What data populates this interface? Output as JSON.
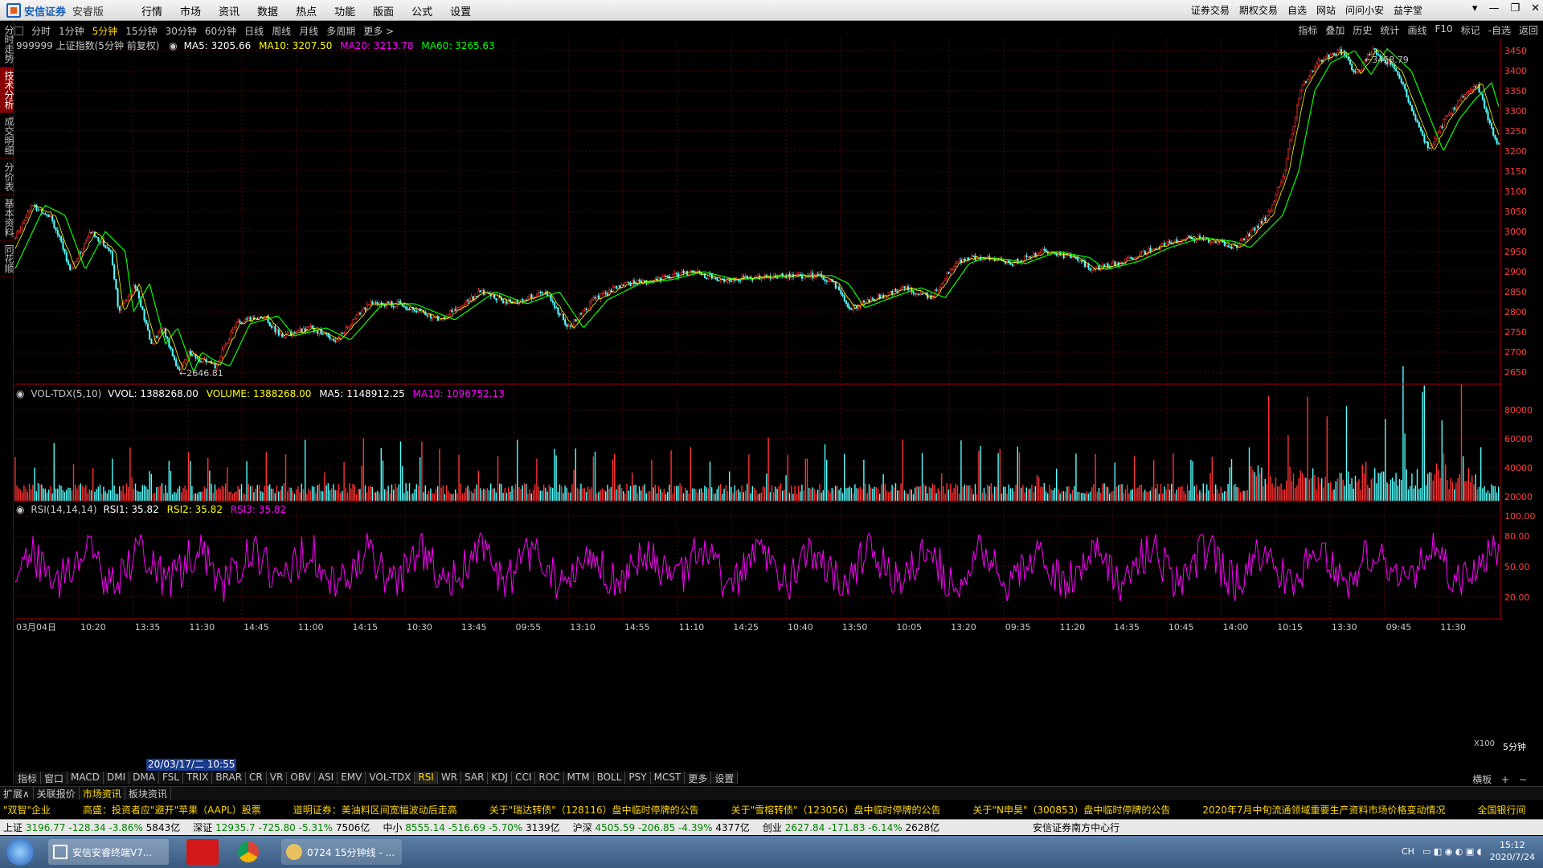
{
  "app": {
    "brand": "安信证券",
    "edition": "安睿版"
  },
  "menu": [
    "行情",
    "市场",
    "资讯",
    "数据",
    "热点",
    "功能",
    "版面",
    "公式",
    "设置"
  ],
  "right_menu": [
    "证券交易",
    "期权交易",
    "自选",
    "网站",
    "问问小安",
    "益学堂"
  ],
  "window_controls": [
    "▾",
    "—",
    "❐",
    "✕"
  ],
  "left_tabs": [
    {
      "label": "分时走势",
      "active": false
    },
    {
      "label": "技术分析",
      "active": true
    },
    {
      "label": "成交明细",
      "active": false
    },
    {
      "label": "分价表",
      "active": false
    },
    {
      "label": "基本资料",
      "active": false
    },
    {
      "label": "同花顺",
      "active": false
    }
  ],
  "periods": [
    "分时",
    "1分钟",
    "5分钟",
    "15分钟",
    "30分钟",
    "60分钟",
    "日线",
    "周线",
    "月线",
    "多周期",
    "更多 >"
  ],
  "selected_period": "5分钟",
  "tools_right": [
    "指标",
    "叠加",
    "历史",
    "统计",
    "画线",
    "F10",
    "标记",
    "-自选",
    "返回"
  ],
  "main_legend": {
    "title": "999999 上证指数(5分钟 前复权)",
    "ma5": "MA5: 3205.66",
    "ma10": "MA10: 3207.50",
    "ma20": "MA20: 3213.78",
    "ma60": "MA60: 3265.63"
  },
  "vol_legend": {
    "title": "VOL-TDX(5,10)",
    "vvol": "VVOL: 1388268.00",
    "volume": "VOLUME: 1388268.00",
    "ma5": "MA5: 1148912.25",
    "ma10": "MA10: 1096752.13"
  },
  "rsi_legend": {
    "title": "RSI(14,14,14)",
    "rsi1": "RSI1: 35.82",
    "rsi2": "RSI2: 35.82",
    "rsi3": "RSI3: 35.82"
  },
  "annotations": {
    "high": "3458.79",
    "low": "2646.81"
  },
  "price_axis": [
    "3450",
    "3400",
    "3350",
    "3300",
    "3250",
    "3200",
    "3150",
    "3100",
    "3050",
    "3000",
    "2950",
    "2900",
    "2850",
    "2800",
    "2750",
    "2700",
    "2650"
  ],
  "vol_axis": [
    "80000",
    "60000",
    "40000",
    "20000"
  ],
  "vol_unit": "X100",
  "rsi_axis": [
    "100.00",
    "80.00",
    "50.00",
    "20.00"
  ],
  "time_axis": [
    "03月04日",
    "10:20",
    "13:35",
    "11:30",
    "14:45",
    "11:00",
    "14:15",
    "10:30",
    "13:45",
    "09:55",
    "13:10",
    "14:55",
    "11:10",
    "14:25",
    "10:40",
    "13:50",
    "10:05",
    "13:20",
    "09:35",
    "11:20",
    "14:35",
    "10:45",
    "14:00",
    "10:15",
    "13:30",
    "09:45",
    "11:30"
  ],
  "cursor_time": "20/03/17/二 10:55",
  "axis_period": "5分钟",
  "indicator_tabs": [
    "指标",
    "窗口",
    "MACD",
    "DMI",
    "DMA",
    "FSL",
    "TRIX",
    "BRAR",
    "CR",
    "VR",
    "OBV",
    "ASI",
    "EMV",
    "VOL-TDX",
    "RSI",
    "WR",
    "SAR",
    "KDJ",
    "CCI",
    "ROC",
    "MTM",
    "BOLL",
    "PSY",
    "MCST",
    "更多",
    "设置"
  ],
  "selected_indicator": "RSI",
  "view_mode": "横板",
  "bottom_tabs": [
    "扩展∧",
    "关联报价",
    "市场资讯",
    "板块资讯"
  ],
  "news": [
    "\"双智\"企业",
    "高盛：投资者应\"避开\"苹果（AAPL）股票",
    "道明证券：美油料区间宽幅波动后走高",
    "关于\"瑞达转债\"（128116）盘中临时停牌的公告",
    "关于\"雪榕转债\"（123056）盘中临时停牌的公告",
    "关于\"N申昊\"（300853）盘中临时停牌的公告",
    "2020年7月中旬流通领域重要生产资料市场价格变动情况",
    "全国银行间"
  ],
  "index_bar": [
    {
      "name": "上证",
      "value": "3196.77 -128.34 -3.86%",
      "amount": "5843亿"
    },
    {
      "name": "深证",
      "value": "12935.7 -725.80 -5.31%",
      "amount": "7506亿"
    },
    {
      "name": "中小",
      "value": "8555.14 -516.69 -5.70%",
      "amount": "3139亿"
    },
    {
      "name": "沪深",
      "value": "4505.59 -206.85 -4.39%",
      "amount": "4377亿"
    },
    {
      "name": "创业",
      "value": "2627.84 -171.83 -6.14%",
      "amount": "2628亿"
    }
  ],
  "server": "安信证券南方中心行",
  "taskbar": {
    "items": [
      "安信安睿终端V7...",
      "",
      "",
      "0724 15分钟线 - ..."
    ],
    "lang": "CH",
    "time": "15:12",
    "date": "2020/7/24"
  },
  "colors": {
    "up": "#ff3232",
    "down": "#54ffff",
    "ma5": "#ffffff",
    "ma10": "#ffff00",
    "ma20": "#ff00ff",
    "ma60": "#00ff00",
    "rsi": "#ff00ff",
    "grid": "#7a0000"
  }
}
